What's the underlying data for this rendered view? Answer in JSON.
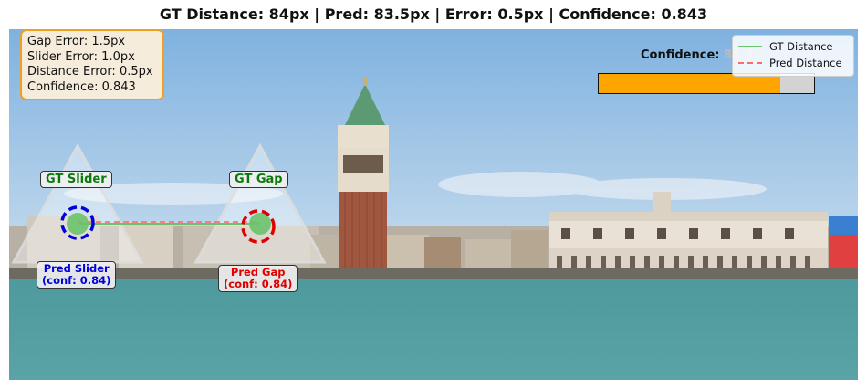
{
  "title": "GT Distance: 84px | Pred: 83.5px | Error: 0.5px | Confidence: 0.843",
  "stats": {
    "gap_error": "Gap Error: 1.5px",
    "slider_error": "Slider Error: 1.0px",
    "distance_error": "Distance Error: 0.5px",
    "confidence": "Confidence: 0.843"
  },
  "confidence_meter": {
    "label": "Confidence:",
    "percent_text": "84.3%",
    "value": 0.843,
    "fill_color": "#ffa500",
    "track_color": "#d3d3d3"
  },
  "legend": {
    "gt_distance": "GT Distance",
    "pred_distance": "Pred Distance",
    "gt_color": "#6cc26c",
    "pred_color": "#ff6b6b"
  },
  "annotations": {
    "gt_slider": "GT Slider",
    "gt_gap": "GT Gap",
    "pred_slider_line1": "Pred Slider",
    "pred_slider_line2": "(conf: 0.84)",
    "pred_gap_line1": "Pred Gap",
    "pred_gap_line2": "(conf: 0.84)"
  },
  "colors": {
    "gt": "#0a7a0a",
    "pred_slider": "#0000dd",
    "pred_gap": "#e00000",
    "stats_border": "#f0a020"
  }
}
